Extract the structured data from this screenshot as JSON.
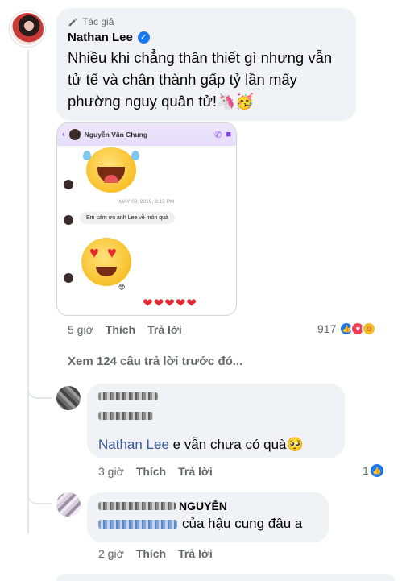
{
  "post": {
    "author_badge": "Tác giả",
    "author_name": "Nathan Lee",
    "text": "Nhiều khi chẳng thân thiết gì nhưng vẫn tử tế và chân thành gấp tỷ lần mấy phường nguỵ quân tử!🦄🥳",
    "time": "5 giờ",
    "like_label": "Thích",
    "reply_label": "Trả lời",
    "reaction_count": "917"
  },
  "screenshot": {
    "contact_name": "Nguyễn Văn Chung",
    "date": "MAY 08, 2019, 8:13 PM",
    "message": "Em cám ơn anh Lee về món quà",
    "hearts": "❤❤❤❤❤"
  },
  "view_more": "Xem 124 câu trả lời trước đó...",
  "replies": [
    {
      "mention": "Nathan Lee",
      "text": " e vẫn chưa có quà🥺",
      "time": "3 giờ",
      "like_label": "Thích",
      "reply_label": "Trả lời",
      "like_count": "1"
    },
    {
      "name_suffix": "NGUYỄN",
      "text": "của hậu cung đâu a",
      "time": "2 giờ",
      "like_label": "Thích",
      "reply_label": "Trả lời"
    }
  ],
  "icons": {
    "author_badge": "pencil-icon",
    "verified": "verified-badge-icon",
    "reactions": [
      "like-icon",
      "love-icon",
      "care-icon"
    ]
  },
  "colors": {
    "bubble": "#f0f2f5",
    "meta_gray": "#65676b",
    "link_blue": "#385898",
    "facebook_blue": "#1877f2"
  }
}
